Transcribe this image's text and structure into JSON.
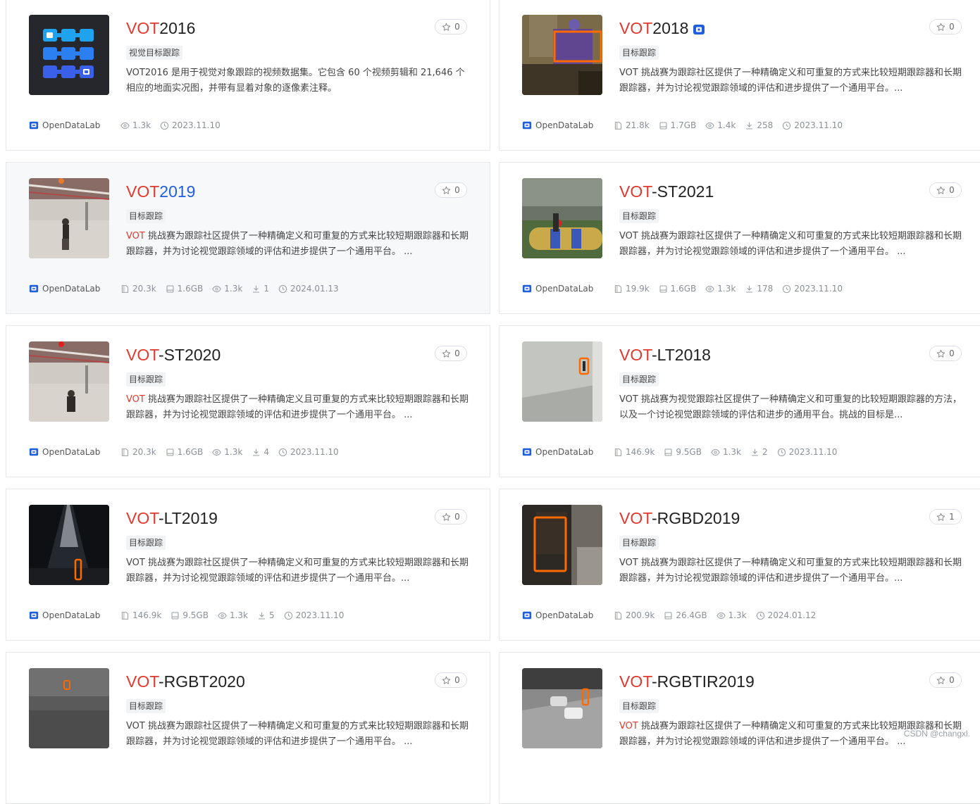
{
  "org_label": "OpenDataLab",
  "watermark": "CSDN @changxl.",
  "cards": [
    {
      "title_hl": "VOT",
      "title_rest": "2016",
      "tag": "视觉目标跟踪",
      "desc_hl": "",
      "desc": "VOT2016 是用于视觉对象跟踪的视频数据集。它包含 60 个视频剪辑和 21,646 个相应的地面实况图，并带有显着对象的逐像素注释。",
      "stars": "0",
      "files": "",
      "size": "",
      "views": "1.3k",
      "downloads": "",
      "date": "2023.11.10"
    },
    {
      "title_hl": "VOT",
      "title_rest": "2018",
      "tag": "目标跟踪",
      "desc_hl": "",
      "desc": "VOT 挑战赛为跟踪社区提供了一种精确定义和可重复的方式来比较短期跟踪器和长期跟踪器，并为讨论视觉跟踪领域的评估和进步提供了一个通用平台。...",
      "stars": "0",
      "files": "21.8k",
      "size": "1.7GB",
      "views": "1.4k",
      "downloads": "258",
      "date": "2023.11.10"
    },
    {
      "title_hl": "VOT",
      "title_rest": "2019",
      "tag": "目标跟踪",
      "desc_hl": "VOT",
      "desc": " 挑战赛为跟踪社区提供了一种精确定义和可重复的方式来比较短期跟踪器和长期跟踪器，并为讨论视觉跟踪领域的评估和进步提供了一个通用平台。 ...",
      "stars": "0",
      "files": "20.3k",
      "size": "1.6GB",
      "views": "1.3k",
      "downloads": "1",
      "date": "2024.01.13"
    },
    {
      "title_hl": "VOT",
      "title_rest": "-ST2021",
      "tag": "目标跟踪",
      "desc_hl": "",
      "desc": "VOT 挑战赛为跟踪社区提供了一种精确定义和可重复的方式来比较短期跟踪器和长期跟踪器，并为讨论视觉跟踪领域的评估和进步提供了一个通用平台。 ...",
      "stars": "0",
      "files": "19.9k",
      "size": "1.6GB",
      "views": "1.3k",
      "downloads": "178",
      "date": "2023.11.10"
    },
    {
      "title_hl": "VOT",
      "title_rest": "-ST2020",
      "tag": "目标跟踪",
      "desc_hl": "VOT",
      "desc": " 挑战赛为跟踪社区提供了一种精确定义且可重复的方式来比较短期跟踪器和长期跟踪器，并为讨论视觉跟踪领域的评估和进步提供了一个通用平台。 ...",
      "stars": "0",
      "files": "20.3k",
      "size": "1.6GB",
      "views": "1.3k",
      "downloads": "4",
      "date": "2023.11.10"
    },
    {
      "title_hl": "VOT",
      "title_rest": "-LT2018",
      "tag": "目标跟踪",
      "desc_hl": "",
      "desc": "VOT 挑战赛为视觉跟踪社区提供了一种精确定义和可重复的比较短期跟踪器的方法，以及一个讨论视觉跟踪领域的评估和进步的通用平台。挑战的目标是...",
      "stars": "0",
      "files": "146.9k",
      "size": "9.5GB",
      "views": "1.3k",
      "downloads": "2",
      "date": "2023.11.10"
    },
    {
      "title_hl": "VOT",
      "title_rest": "-LT2019",
      "tag": "目标跟踪",
      "desc_hl": "",
      "desc": "VOT 挑战赛为跟踪社区提供了一种精确定义和可重复的方式来比较短期跟踪器和长期跟踪器，并为讨论视觉跟踪领域的评估和进步提供了一个通用平台。...",
      "stars": "0",
      "files": "146.9k",
      "size": "9.5GB",
      "views": "1.3k",
      "downloads": "5",
      "date": "2023.11.10"
    },
    {
      "title_hl": "VOT",
      "title_rest": "-RGBD2019",
      "tag": "目标跟踪",
      "desc_hl": "",
      "desc": "VOT 挑战赛为跟踪社区提供了一种精确定义和可重复的方式来比较短期跟踪器和长期跟踪器，并为讨论视觉跟踪领域的评估和进步提供了一个通用平台。...",
      "stars": "1",
      "files": "200.9k",
      "size": "26.4GB",
      "views": "1.3k",
      "downloads": "",
      "date": "2024.01.12"
    },
    {
      "title_hl": "VOT",
      "title_rest": "-RGBT2020",
      "tag": "目标跟踪",
      "desc_hl": "",
      "desc": "VOT 挑战赛为跟踪社区提供了一种精确定义和可重复的方式来比较短期跟踪器和长期跟踪器，并为讨论视觉跟踪领域的评估和进步提供了一个通用平台。 ...",
      "stars": "0",
      "files": "",
      "size": "",
      "views": "",
      "downloads": "",
      "date": ""
    },
    {
      "title_hl": "VOT",
      "title_rest": "-RGBTIR2019",
      "tag": "目标跟踪",
      "desc_hl": "VOT",
      "desc": " 挑战赛为跟踪社区提供了一种精确定义和可重复的方式来比较短期跟踪器和长期跟踪器，并为讨论视觉跟踪领域的评估和进步提供了一个通用平台。 ...",
      "stars": "0",
      "files": "",
      "size": "",
      "views": "",
      "downloads": "",
      "date": ""
    }
  ]
}
